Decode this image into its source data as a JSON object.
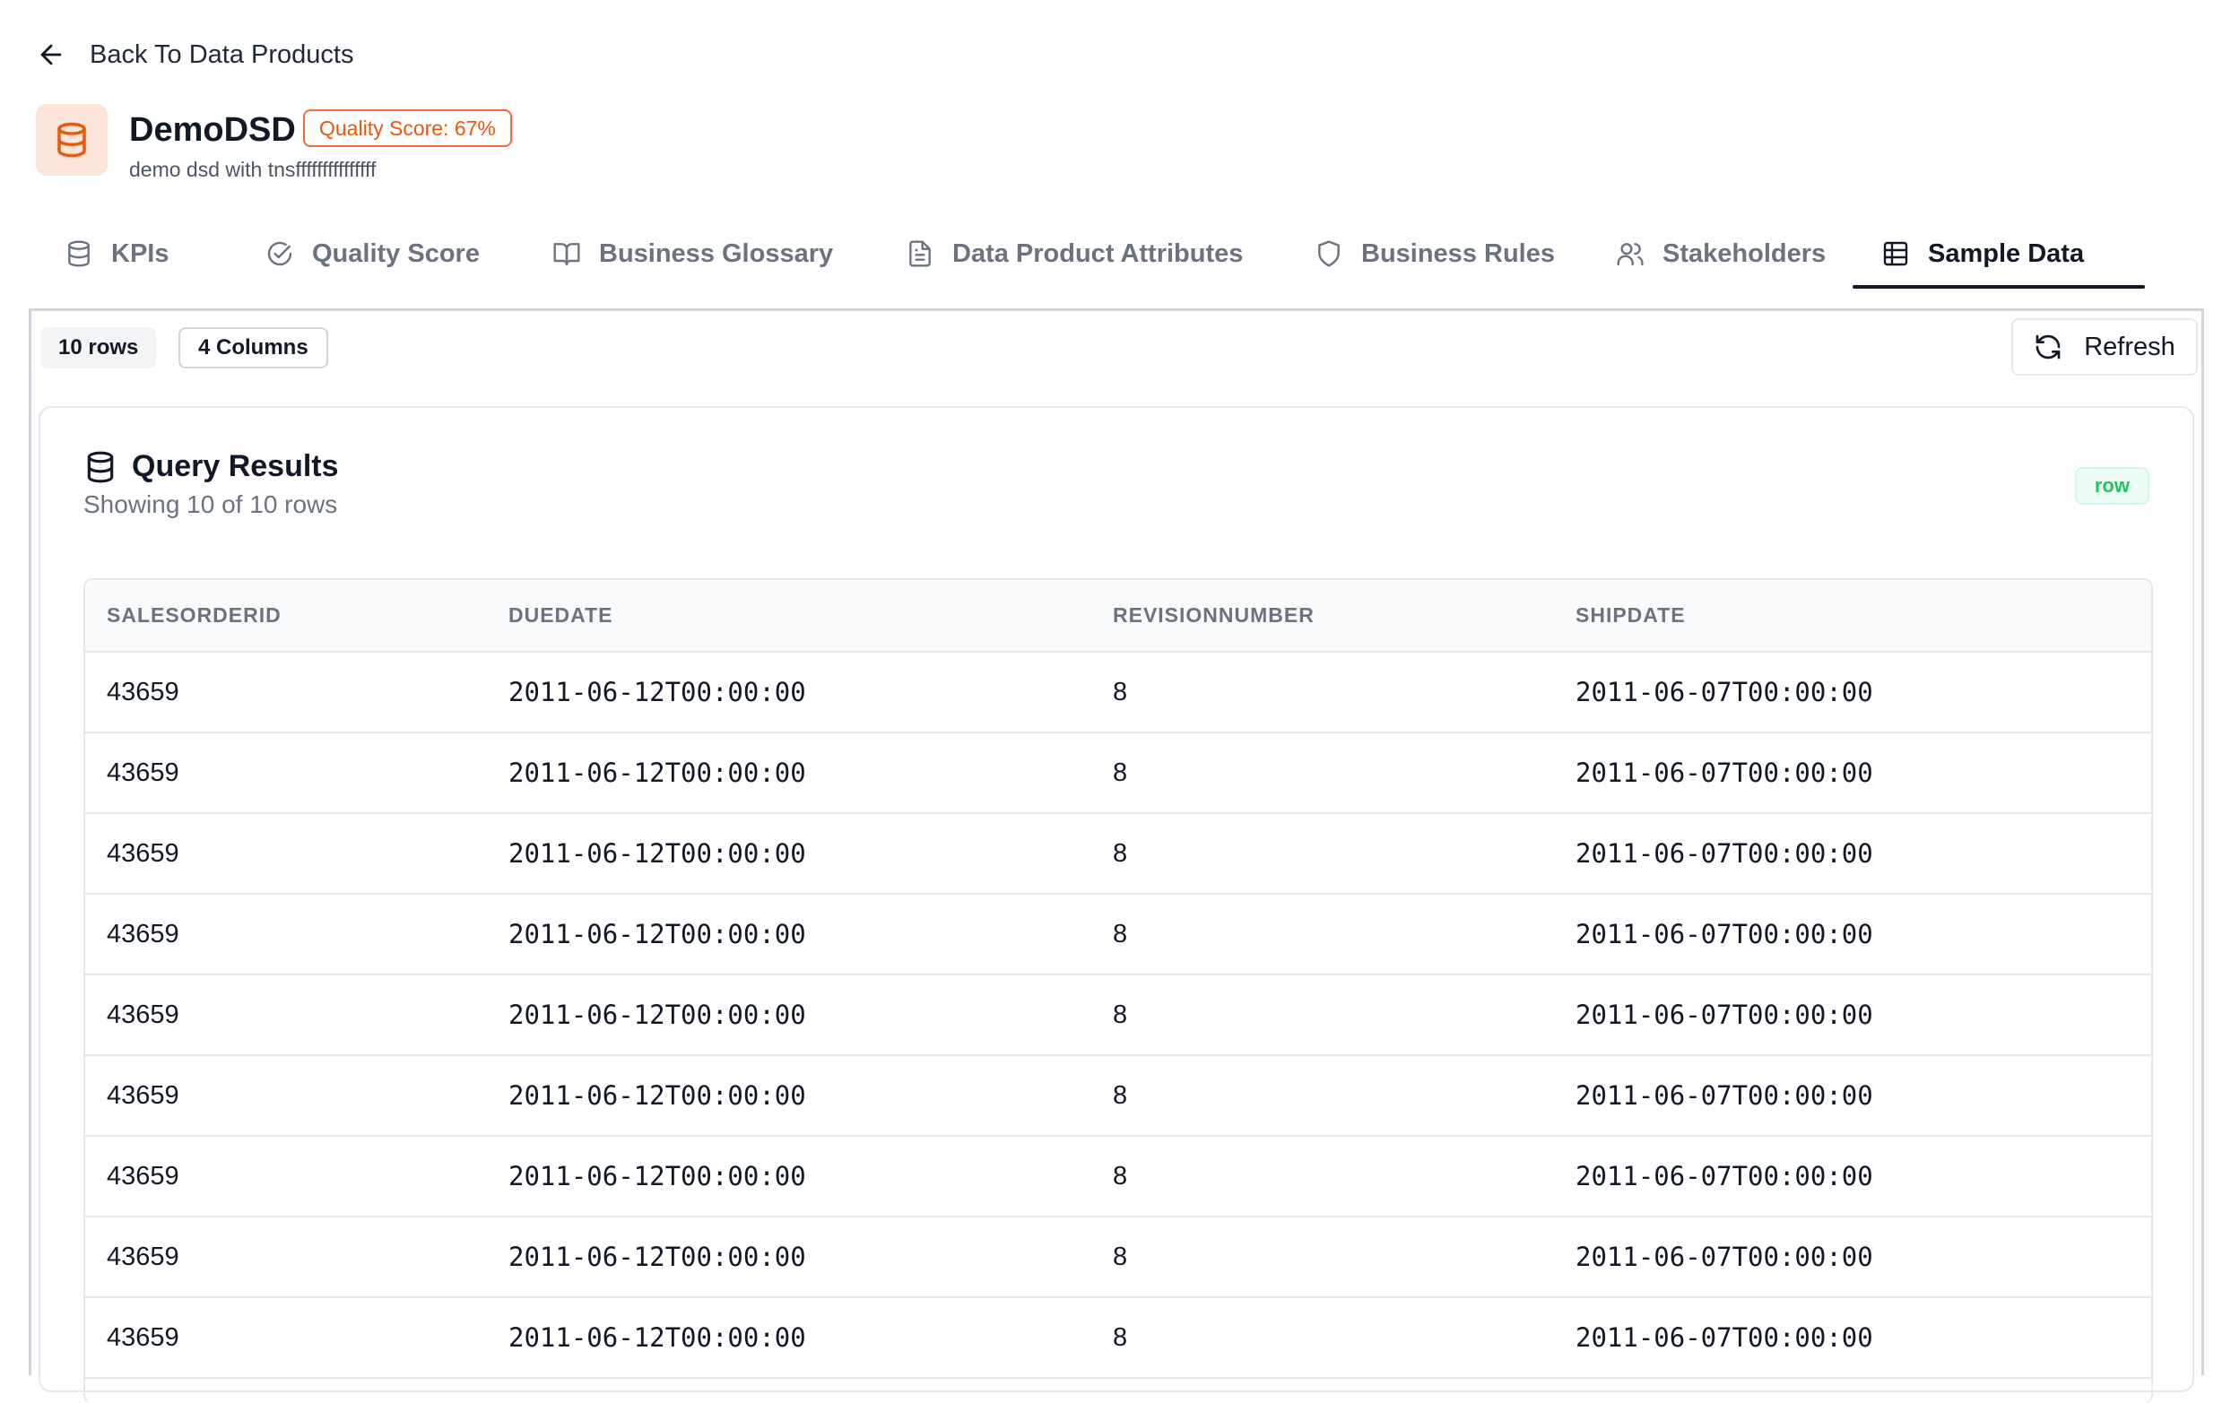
{
  "back_link": {
    "label": "Back To Data Products",
    "icon": "arrow-left-icon"
  },
  "product": {
    "icon": "database-icon",
    "title": "DemoDSD",
    "quality_badge": "Quality Score: 67%",
    "description": "demo dsd with tnsfffffffffffffff",
    "accent_color": "#ea580c"
  },
  "tabs": [
    {
      "label": "KPIs",
      "icon": "database-icon"
    },
    {
      "label": "Quality Score",
      "icon": "check-circle-icon"
    },
    {
      "label": "Business Glossary",
      "icon": "book-icon"
    },
    {
      "label": "Data Product Attributes",
      "icon": "document-icon"
    },
    {
      "label": "Business Rules",
      "icon": "shield-icon"
    },
    {
      "label": "Stakeholders",
      "icon": "users-icon"
    },
    {
      "label": "Sample Data",
      "icon": "table-icon",
      "active": true
    }
  ],
  "toolbar": {
    "rows_chip": "10 rows",
    "columns_chip": "4 Columns",
    "refresh_label": "Refresh"
  },
  "results": {
    "title": "Query Results",
    "subtitle": "Showing 10 of 10 rows",
    "badge": "row",
    "columns": [
      "SALESORDERID",
      "DUEDATE",
      "REVISIONNUMBER",
      "SHIPDATE"
    ],
    "rows": [
      [
        "43659",
        "2011-06-12T00:00:00",
        "8",
        "2011-06-07T00:00:00"
      ],
      [
        "43659",
        "2011-06-12T00:00:00",
        "8",
        "2011-06-07T00:00:00"
      ],
      [
        "43659",
        "2011-06-12T00:00:00",
        "8",
        "2011-06-07T00:00:00"
      ],
      [
        "43659",
        "2011-06-12T00:00:00",
        "8",
        "2011-06-07T00:00:00"
      ],
      [
        "43659",
        "2011-06-12T00:00:00",
        "8",
        "2011-06-07T00:00:00"
      ],
      [
        "43659",
        "2011-06-12T00:00:00",
        "8",
        "2011-06-07T00:00:00"
      ],
      [
        "43659",
        "2011-06-12T00:00:00",
        "8",
        "2011-06-07T00:00:00"
      ],
      [
        "43659",
        "2011-06-12T00:00:00",
        "8",
        "2011-06-07T00:00:00"
      ],
      [
        "43659",
        "2011-06-12T00:00:00",
        "8",
        "2011-06-07T00:00:00"
      ]
    ]
  }
}
